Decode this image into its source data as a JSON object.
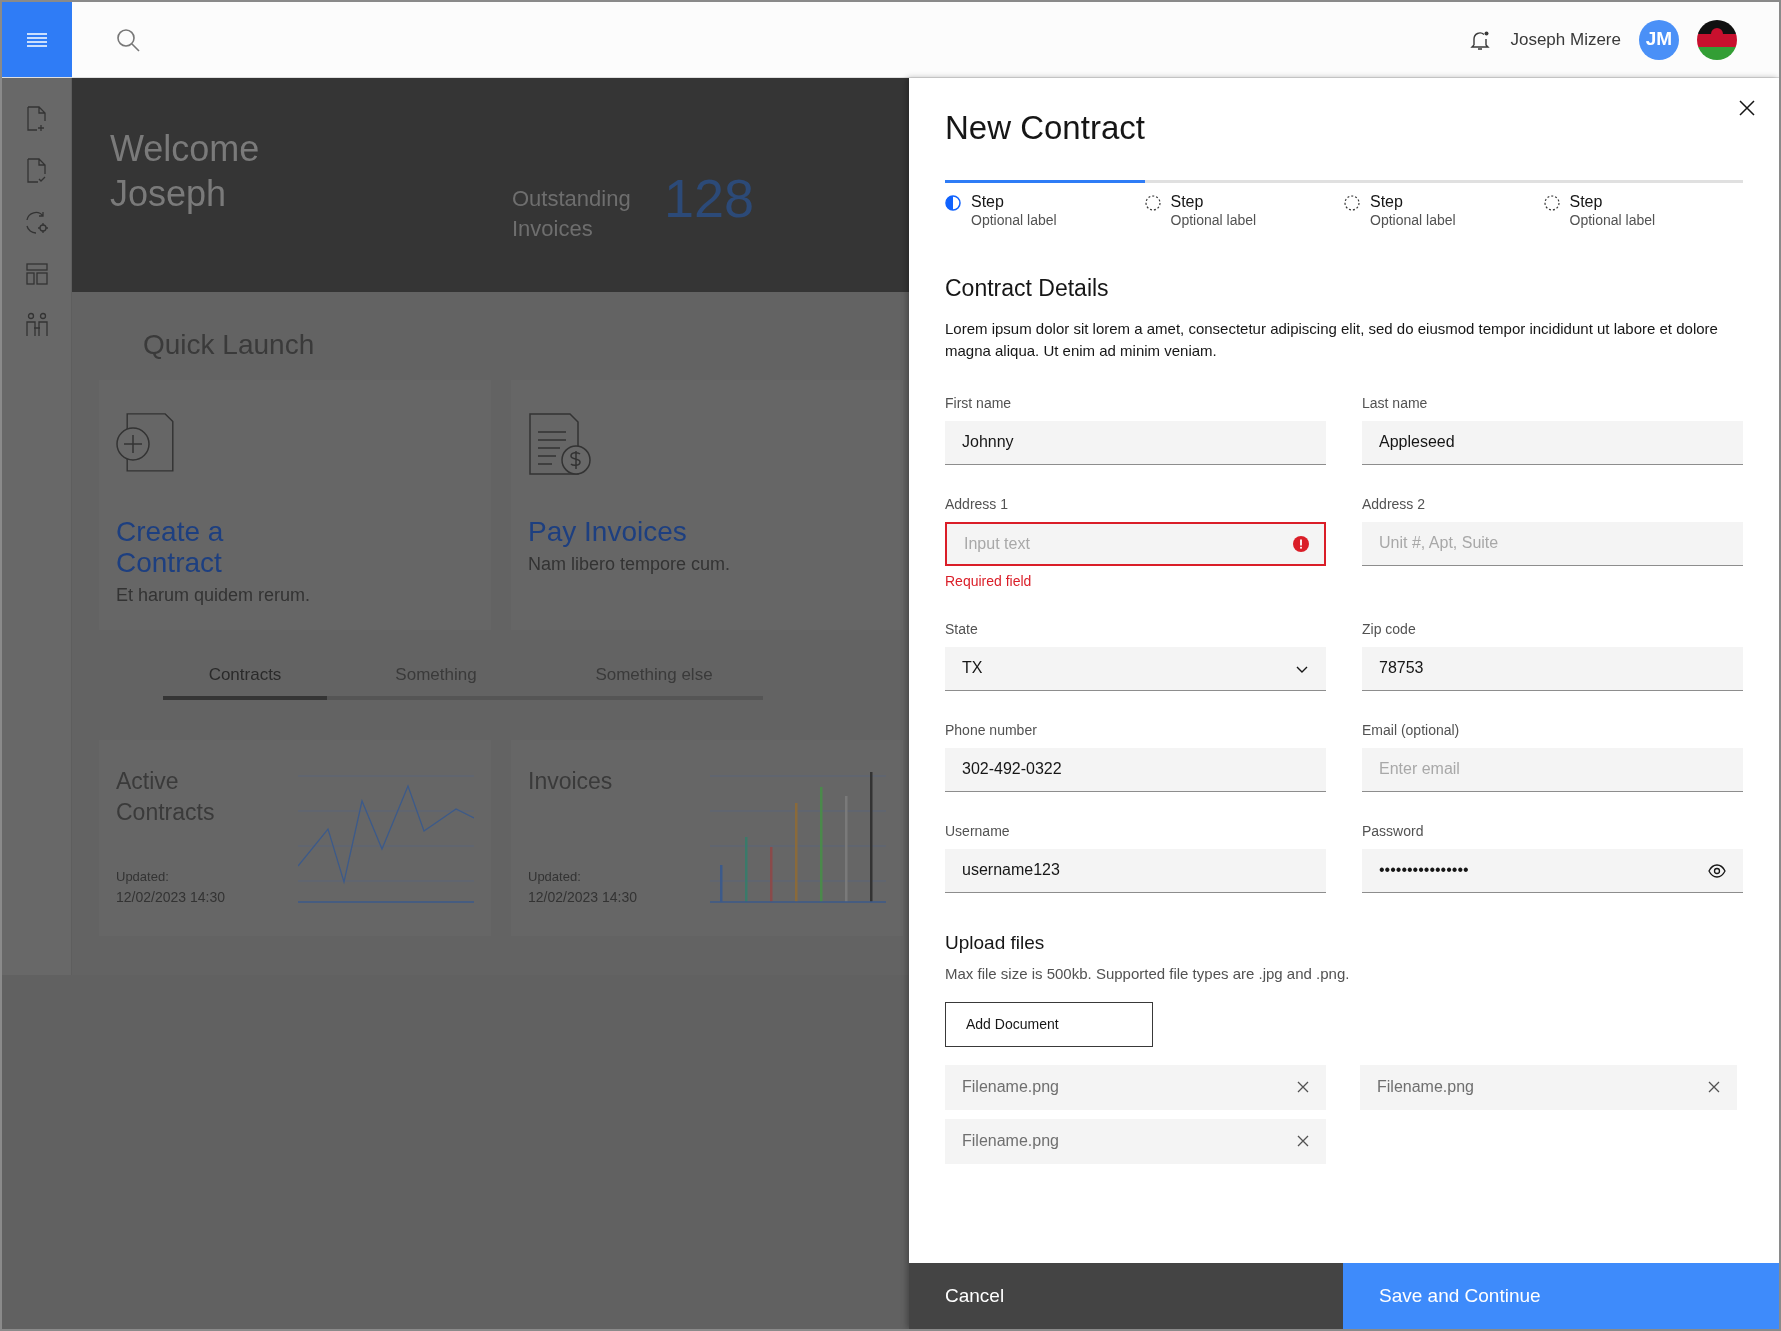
{
  "header": {
    "user_name": "Joseph Mizere",
    "avatar_initials": "JM"
  },
  "banner": {
    "welcome": "Welcome Joseph",
    "stat_label": "Outstanding Invoices",
    "stat_value": "128"
  },
  "quick_launch": {
    "title": "Quick Launch",
    "cards": [
      {
        "kind": "contract",
        "title": "Create a Contract",
        "description": "Et harum quidem rerum."
      },
      {
        "kind": "invoice",
        "title": "Pay Invoices",
        "description": "Nam libero tempore cum."
      }
    ]
  },
  "tabs": [
    {
      "label": "Contracts",
      "selected": true
    },
    {
      "label": "Something",
      "selected": false
    },
    {
      "label": "Something else",
      "selected": false
    }
  ],
  "summary_cards": [
    {
      "kind": "line",
      "title": "Active Contracts",
      "updated_label": "Updated:",
      "updated": "12/02/2023 14:30"
    },
    {
      "kind": "bar",
      "title": "Invoices",
      "updated_label": "Updated:",
      "updated": "12/02/2023 14:30"
    }
  ],
  "modal": {
    "title": "New Contract",
    "steps": [
      {
        "label": "Step",
        "sublabel": "Optional label",
        "active": true
      },
      {
        "label": "Step",
        "sublabel": "Optional label",
        "active": false
      },
      {
        "label": "Step",
        "sublabel": "Optional label",
        "active": false
      },
      {
        "label": "Step",
        "sublabel": "Optional label",
        "active": false
      }
    ],
    "section_title": "Contract Details",
    "description": "Lorem ipsum dolor sit lorem a amet, consectetur adipiscing elit, sed do eiusmod tempor incididunt ut labore et dolore magna aliqua. Ut enim ad minim veniam.",
    "fields": [
      {
        "kind": "text",
        "label": "First name",
        "value": "Johnny"
      },
      {
        "kind": "text",
        "label": "Last name",
        "value": "Appleseed"
      },
      {
        "kind": "text",
        "label": "Address 1",
        "placeholder": "Input text",
        "error": "Required field"
      },
      {
        "kind": "text",
        "label": "Address 2",
        "placeholder": "Unit #, Apt, Suite"
      },
      {
        "kind": "select",
        "label": "State",
        "value": "TX"
      },
      {
        "kind": "text",
        "label": "Zip code",
        "value": "78753"
      },
      {
        "kind": "text",
        "label": "Phone number",
        "value": "302-492-0322"
      },
      {
        "kind": "text",
        "label": "Email (optional)",
        "placeholder": "Enter email"
      },
      {
        "kind": "text",
        "label": "Username",
        "value": "username123"
      },
      {
        "kind": "password",
        "label": "Password",
        "value": "••••••••••••••••"
      }
    ],
    "upload": {
      "title": "Upload files",
      "hint": "Max file size is 500kb. Supported file types are .jpg and .png.",
      "button": "Add Document",
      "files": [
        "Filename.png",
        "Filename.png",
        "Filename.png"
      ]
    },
    "cancel": "Cancel",
    "submit": "Save and Continue"
  }
}
